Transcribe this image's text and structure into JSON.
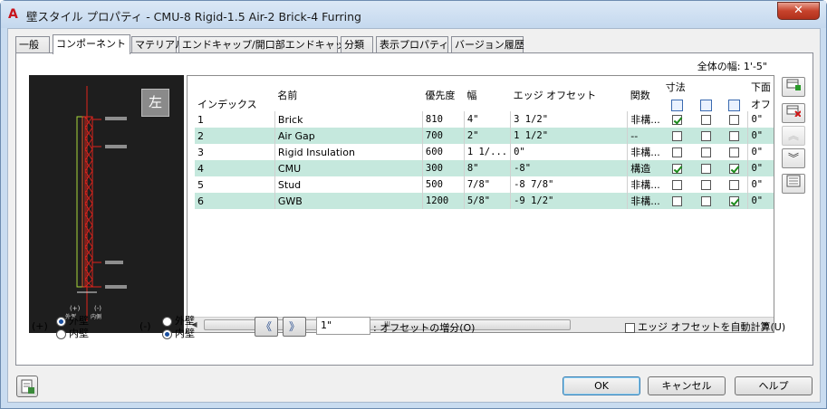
{
  "window": {
    "title": "壁スタイル プロパティ - CMU-8 Rigid-1.5 Air-2 Brick-4 Furring",
    "app_icon": "A",
    "close_label": "✕"
  },
  "tabs": [
    "一般",
    "コンポーネント",
    "マテリアル",
    "エンドキャップ/開口部エンドキャップ",
    "分類",
    "表示プロパティ",
    "バージョン履歴"
  ],
  "active_tab": 1,
  "total_width": "全体の幅: 1'-5\"",
  "preview": {
    "view_label": "左",
    "plus_label": "(+)",
    "minus_label": "(-)",
    "outer_label": "外側",
    "inner_label": "内側"
  },
  "grid": {
    "headers": {
      "index": "インデックス",
      "name": "名前",
      "priority": "優先度",
      "width": "幅",
      "edge_offset": "エッジ オフセット",
      "function": "関数",
      "dimension": "寸法",
      "bottom": "下面",
      "offset": "オフ"
    },
    "rows": [
      {
        "index": "1",
        "name": "Brick",
        "priority": "810",
        "width": "4\"",
        "edge_offset": "3 1/2\"",
        "function": "非構...",
        "c1": true,
        "c2": false,
        "c3": false,
        "bottom": "0\""
      },
      {
        "index": "2",
        "name": "Air Gap",
        "priority": "700",
        "width": "2\"",
        "edge_offset": "1 1/2\"",
        "function": "--",
        "c1": false,
        "c2": false,
        "c3": false,
        "bottom": "0\""
      },
      {
        "index": "3",
        "name": "Rigid Insulation",
        "priority": "600",
        "width": "1 1/...",
        "edge_offset": "0\"",
        "function": "非構...",
        "c1": false,
        "c2": false,
        "c3": false,
        "bottom": "0\""
      },
      {
        "index": "4",
        "name": "CMU",
        "priority": "300",
        "width": "8\"",
        "edge_offset": "-8\"",
        "function": "構造",
        "c1": true,
        "c2": false,
        "c3": true,
        "bottom": "0\""
      },
      {
        "index": "5",
        "name": "Stud",
        "priority": "500",
        "width": "7/8\"",
        "edge_offset": "-8 7/8\"",
        "function": "非構...",
        "c1": false,
        "c2": false,
        "c3": false,
        "bottom": "0\""
      },
      {
        "index": "6",
        "name": "GWB",
        "priority": "1200",
        "width": "5/8\"",
        "edge_offset": "-9 1/2\"",
        "function": "非構...",
        "c1": false,
        "c2": false,
        "c3": true,
        "bottom": "0\""
      }
    ],
    "scroll_grip": "III"
  },
  "side_buttons": [
    "add-icon",
    "delete-icon",
    "move-up-icon",
    "move-down-icon",
    "properties-icon"
  ],
  "plus_side": {
    "label": "(+)",
    "option_outer": "外壁",
    "option_inner": "内壁",
    "selected": "外壁"
  },
  "minus_side": {
    "label": "(-)",
    "option_outer": "外壁",
    "option_inner": "内壁",
    "selected": "内壁"
  },
  "offset_increment": {
    "value": "1\"",
    "label": ": オフセットの増分(O)"
  },
  "auto_calc": {
    "label": "エッジ オフセットを自動計算(U)",
    "checked": false
  },
  "buttons": {
    "ok": "OK",
    "cancel": "キャンセル",
    "help": "ヘルプ"
  },
  "colors": {
    "row_alt": "#c5e8dd",
    "preview_bg": "#1e1e1e",
    "layer_red": "#e0241c",
    "layer_green": "#a8d83c"
  }
}
